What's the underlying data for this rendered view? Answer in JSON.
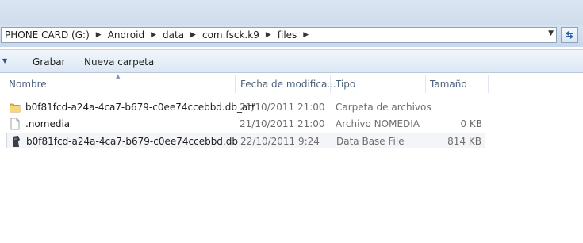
{
  "address": {
    "crumbs": [
      "PHONE CARD (G:)",
      "Android",
      "data",
      "com.fsck.k9",
      "files"
    ],
    "refresh_icon": "refresh-arrows-icon",
    "dropdown_icon": "chevron-down-icon"
  },
  "toolbar": {
    "organize_icon": "chevron-down-icon",
    "burn_label": "Grabar",
    "new_folder_label": "Nueva carpeta"
  },
  "columns": {
    "name": "Nombre",
    "date": "Fecha de modifica...",
    "type": "Tipo",
    "size": "Tamaño"
  },
  "files": [
    {
      "name": "b0f81fcd-a24a-4ca7-b679-c0ee74ccebbd.db_att",
      "date": "21/10/2011 21:00",
      "type": "Carpeta de archivos",
      "size": "",
      "icon": "folder-icon"
    },
    {
      "name": ".nomedia",
      "date": "21/10/2011 21:00",
      "type": "Archivo NOMEDIA",
      "size": "0 KB",
      "icon": "blank-file-icon"
    },
    {
      "name": "b0f81fcd-a24a-4ca7-b679-c0ee74ccebbd.db",
      "date": "22/10/2011 9:24",
      "type": "Data Base File",
      "size": "814 KB",
      "icon": "database-file-icon"
    }
  ]
}
